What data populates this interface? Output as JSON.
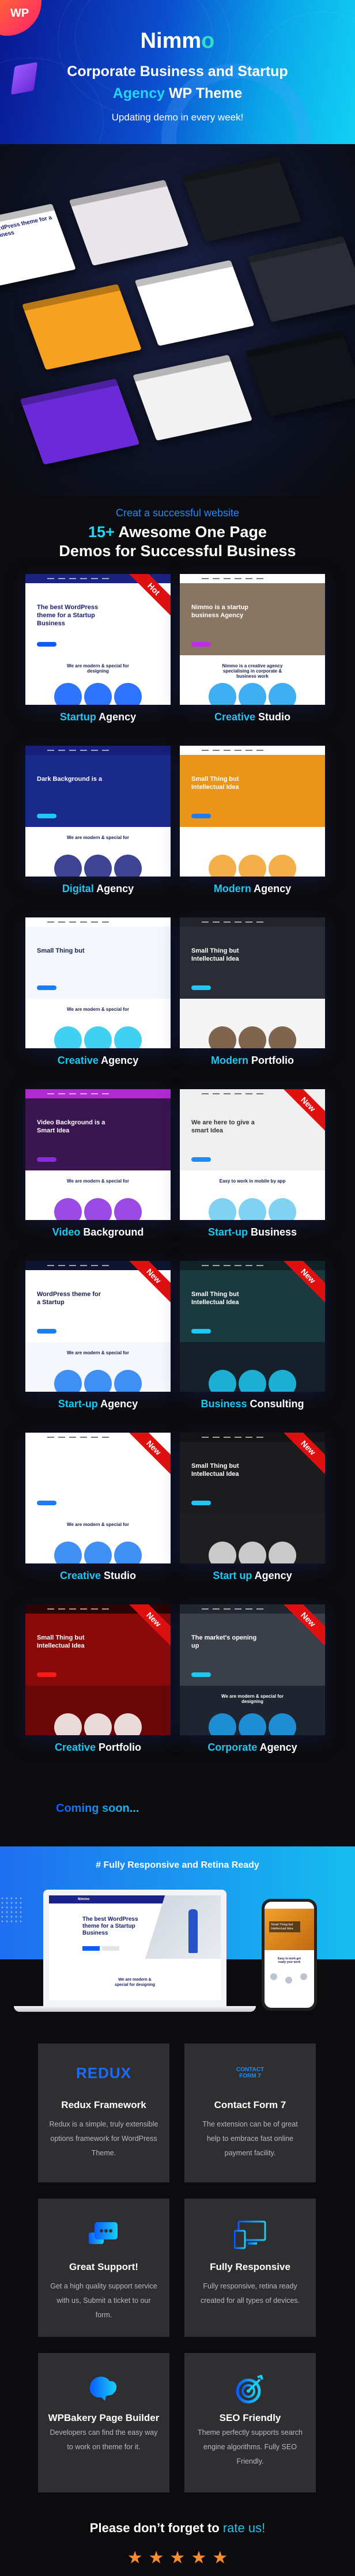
{
  "hero": {
    "badge": "WP",
    "brand_main": "Nimm",
    "brand_accent": "o",
    "subtitle_line1": "Corporate Business and Startup",
    "subtitle_line2_accent": "Agency",
    "subtitle_line2_rest": " WP Theme",
    "tagline": "Updating demo in every week!"
  },
  "collage": [
    {
      "text": "The best WordPress theme for a Startup Business",
      "bg": "#ffffff",
      "fg": "#1a1f6e"
    },
    {
      "text": "",
      "bg": "#e8e6ea",
      "fg": "#222"
    },
    {
      "text": "",
      "bg": "#1a1c22",
      "fg": "#fff"
    },
    {
      "text": "",
      "bg": "#f6a11f",
      "fg": "#fff"
    },
    {
      "text": "",
      "bg": "#ffffff",
      "fg": "#222"
    },
    {
      "text": "",
      "bg": "#2a2d36",
      "fg": "#fff"
    },
    {
      "text": "",
      "bg": "#6a2ad8",
      "fg": "#fff"
    },
    {
      "text": "",
      "bg": "#f2f2f2",
      "fg": "#222"
    },
    {
      "text": "",
      "bg": "#101418",
      "fg": "#fff"
    }
  ],
  "demos_section": {
    "kicker": "Creat a successful website",
    "headline_accent": "15+",
    "headline_line1_rest": " Awesome One Page",
    "headline_line2": "Demos for Successful Business",
    "items": [
      {
        "accent": "Startup",
        "rest": " Agency",
        "badge": "Hot",
        "hero_text": "The best WordPress theme for a Startup Business",
        "lower_text": "We are modern & special for designing",
        "hero_bg": "#ffffff",
        "nav_bg": "#1a2380",
        "fg": "#1a1f6e",
        "btn": "#0a5cff",
        "lower_bg": "#ffffff",
        "accent_color": "#0a5cff"
      },
      {
        "accent": "Creative",
        "rest": " Studio",
        "badge": "",
        "hero_text": "Nimmo is a startup business Agency",
        "lower_text": "Nimmo is a creative agency specialising in corporate & business work",
        "hero_bg": "#8a7462",
        "nav_bg": "#ffffff",
        "fg": "#ffffff",
        "btn": "#c22aef",
        "lower_bg": "#ffffff",
        "accent_color": "#1ea0f0"
      },
      {
        "accent": "Digital",
        "rest": " Agency",
        "badge": "",
        "hero_text": "Dark Background is a",
        "lower_text": "We are modern & special for",
        "hero_bg": "#1a2a8a",
        "nav_bg": "#16207a",
        "fg": "#ffffff",
        "btn": "#1ec8f2",
        "lower_bg": "#ffffff",
        "accent_color": "#1a2380"
      },
      {
        "accent": "Modern",
        "rest": " Agency",
        "badge": "",
        "hero_text": "Small Thing but Intellectual Idea",
        "lower_text": "",
        "hero_bg": "#e8951a",
        "nav_bg": "#ffffff",
        "fg": "#ffffff",
        "btn": "#1e7cf2",
        "lower_bg": "#ffffff",
        "accent_color": "#f2a12a"
      },
      {
        "accent": "Creative",
        "rest": " Agency",
        "badge": "",
        "hero_text": "Small Thing but",
        "lower_text": "We are modern & special for",
        "hero_bg": "#f3f6fb",
        "nav_bg": "#ffffff",
        "fg": "#1a1f4e",
        "btn": "#1e7cf2",
        "lower_bg": "#ffffff",
        "accent_color": "#1ec8f2"
      },
      {
        "accent": "Modern",
        "rest": " Portfolio",
        "badge": "",
        "hero_text": "Small Thing but Intellectual Idea",
        "lower_text": "",
        "hero_bg": "#2a2d36",
        "nav_bg": "#22252c",
        "fg": "#ffffff",
        "btn": "#1ec8f2",
        "lower_bg": "#f4f4f4",
        "accent_color": "#6a4a30"
      },
      {
        "accent": "Video",
        "rest": " Background",
        "badge": "",
        "hero_text": "Video Background is a Smart Idea",
        "lower_text": "We are modern & special for",
        "hero_bg": "#3a1550",
        "nav_bg": "#b02ad0",
        "fg": "#ffffff",
        "btn": "#8a2ae0",
        "lower_bg": "#ffffff",
        "accent_color": "#8a2ae0"
      },
      {
        "accent": "Start-up",
        "rest": " Business",
        "badge": "New",
        "hero_text": "We are here to give a smart Idea",
        "lower_text": "Easy to work in mobile by app",
        "hero_bg": "#efefef",
        "nav_bg": "#efefef",
        "fg": "#333333",
        "btn": "#1e8cf2",
        "lower_bg": "#ffffff",
        "accent_color": "#6acaf0"
      },
      {
        "accent": "Start-up",
        "rest": " Agency",
        "badge": "New",
        "hero_text": "WordPress theme for a Startup",
        "lower_text": "We are modern & special for",
        "hero_bg": "#ffffff",
        "nav_bg": "#0f1430",
        "fg": "#1a1f4e",
        "btn": "#1e7cf2",
        "lower_bg": "#f4f7fb",
        "accent_color": "#1e7cf2"
      },
      {
        "accent": "Business",
        "rest": " Consulting",
        "badge": "New",
        "hero_text": "Small Thing but Intellectual Idea",
        "lower_text": "",
        "hero_bg": "#1a3a40",
        "nav_bg": "#102428",
        "fg": "#ffffff",
        "btn": "#1ec8f2",
        "lower_bg": "#16202a",
        "accent_color": "#1ec8f2"
      },
      {
        "accent": "Creative",
        "rest": " Studio",
        "badge": "New",
        "hero_text": "",
        "lower_text": "We are modern & special for",
        "hero_bg": "#ffffff",
        "nav_bg": "#ffffff",
        "fg": "#1a1f4e",
        "btn": "#1e7cf2",
        "lower_bg": "#ffffff",
        "accent_color": "#1e7cf2"
      },
      {
        "accent": "Start up",
        "rest": " Agency",
        "badge": "New",
        "hero_text": "Small Thing but Intellectual Idea",
        "lower_text": "",
        "hero_bg": "#1c1c1e",
        "nav_bg": "#141416",
        "fg": "#ffffff",
        "btn": "#1ec8f2",
        "lower_bg": "#1e1e20",
        "accent_color": "#e8e8e8"
      },
      {
        "accent": "Creative",
        "rest": " Portfolio",
        "badge": "New",
        "hero_text": "Small Thing but Intellectual Idea",
        "lower_text": "",
        "hero_bg": "#8a0a0a",
        "nav_bg": "#2a0505",
        "fg": "#ffffff",
        "btn": "#ff1a1a",
        "lower_bg": "#6a0808",
        "accent_color": "#ffffff"
      },
      {
        "accent": "Corporate",
        "rest": " Agency",
        "badge": "New",
        "hero_text": "The market's opening up",
        "lower_text": "We are modern & special for designing",
        "hero_bg": "#3a3f4a",
        "nav_bg": "#22262e",
        "fg": "#ffffff",
        "btn": "#1ec8f2",
        "lower_bg": "#1e2430",
        "accent_color": "#1ea0f0"
      }
    ],
    "coming_soon": "Coming soon..."
  },
  "responsive": {
    "title": "# Fully Responsive and Retina Ready",
    "laptop_brand": "Nimmo",
    "laptop_hero": "The best WordPress theme for a Startup Business",
    "laptop_lower": "We are modern & special for designing",
    "phone_hero": "Small Thing but Intellectual Idea",
    "phone_lower": "Easy to work get ready your work"
  },
  "features": [
    {
      "icon": "redux-logo",
      "logo_text": "REDUX",
      "title": "Redux Framework",
      "desc": "Redux is a simple, truly extensible options framework for WordPress Theme."
    },
    {
      "icon": "contact-form-7-logo",
      "logo_text": "CONTACT FORM 7",
      "title": "Contact Form 7",
      "desc": "The extension can be of great help to embrace fast online payment facility."
    },
    {
      "icon": "chat-bubbles-icon",
      "title": "Great Support!",
      "desc": "Get a high quality support service with us, Submit a ticket to our form."
    },
    {
      "icon": "devices-icon",
      "title": "Fully Responsive",
      "desc": "Fully responsive, retina ready created for all types of devices."
    },
    {
      "icon": "wpbakery-icon",
      "title": "WPBakery Page Builder",
      "desc": "Developers can find the easy way to work on theme for it."
    },
    {
      "icon": "target-icon",
      "title": "SEO Friendly",
      "desc": "Theme perfectly supports search engine algorithms. Fully SEO Friendly."
    }
  ],
  "rating": {
    "text": "Please don’t forget to ",
    "accent": "rate us!",
    "stars": 5,
    "max_stars": 5
  },
  "colors": {
    "accent_cyan": "#1ec8f2",
    "accent_blue": "#0a5cff",
    "star": "#ff8a30",
    "card_bg": "#2f2f31",
    "page_bg": "#0c0c0e"
  }
}
